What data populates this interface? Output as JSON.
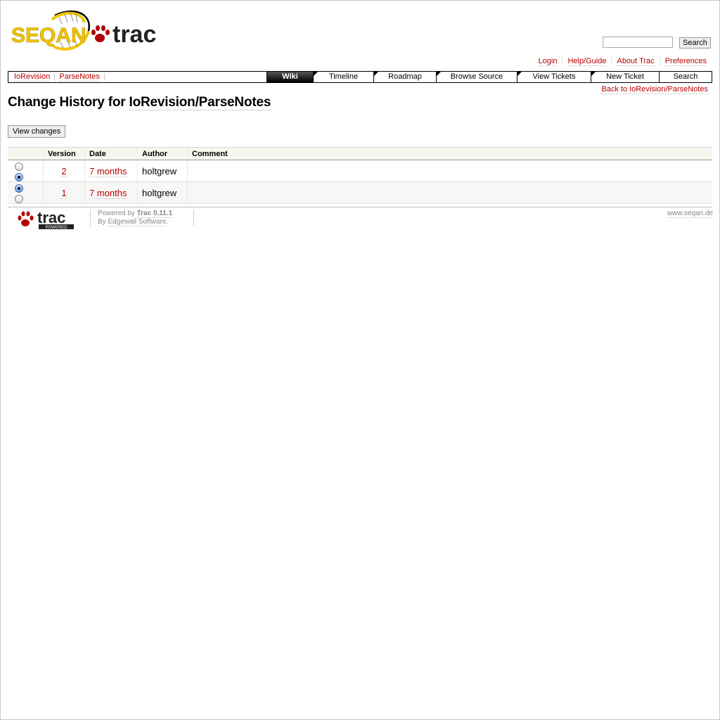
{
  "header": {
    "logo_text_left": "SEQAN",
    "logo_text_right": "trac",
    "search_button": "Search"
  },
  "metanav": [
    "Login",
    "Help/Guide",
    "About Trac",
    "Preferences"
  ],
  "context": {
    "crumbs": [
      "IoRevision",
      "ParseNotes"
    ]
  },
  "mainnav": {
    "tabs": [
      "Wiki",
      "Timeline",
      "Roadmap",
      "Browse Source",
      "View Tickets",
      "New Ticket",
      "Search"
    ],
    "active": "Wiki"
  },
  "backlink": "Back to IoRevision/ParseNotes",
  "page": {
    "title_prefix": "Change History for ",
    "title_link": "IoRevision/ParseNotes",
    "view_changes": "View changes"
  },
  "history": {
    "columns": [
      "",
      "Version",
      "Date",
      "Author",
      "Comment"
    ],
    "rows": [
      {
        "old": false,
        "new": true,
        "version": "2",
        "date": "7 months",
        "author": "holtgrew",
        "comment": ""
      },
      {
        "old": true,
        "new": false,
        "version": "1",
        "date": "7 months",
        "author": "holtgrew",
        "comment": ""
      }
    ]
  },
  "footer": {
    "logo_text": "trac",
    "logo_sub": "POWERED",
    "powered_by": "Powered by ",
    "trac_version": "Trac 0.11.1",
    "by": "By ",
    "vendor": "Edgewall Software",
    "vendor_suffix": ".",
    "site": "www.seqan.de"
  },
  "colors": {
    "link": "#bb0000",
    "logo_yellow": "#f2c500",
    "logo_red": "#b00000"
  }
}
